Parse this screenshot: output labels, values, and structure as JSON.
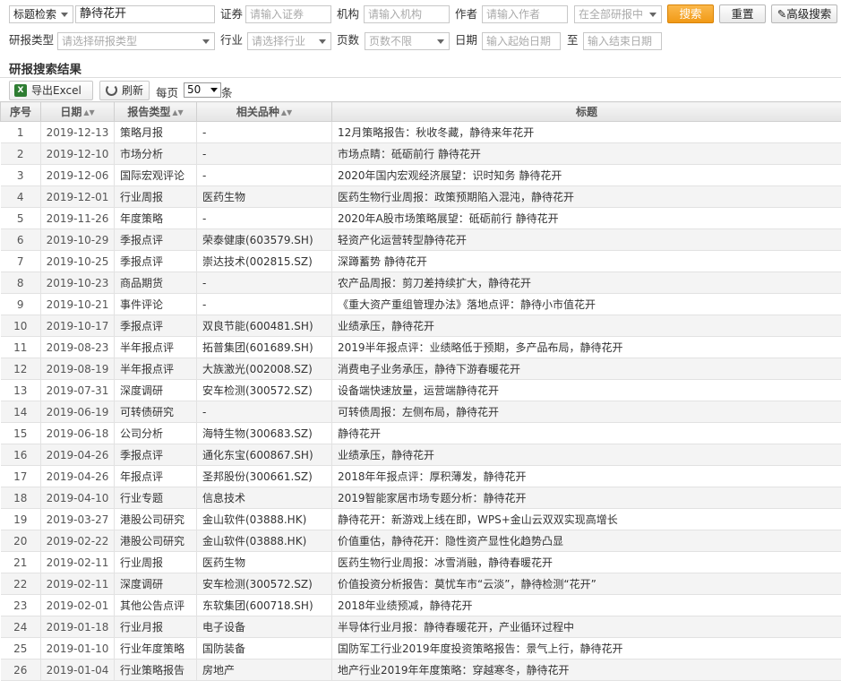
{
  "search": {
    "mode": "标题检索",
    "keyword": "静待花开",
    "security_label": "证券",
    "security_placeholder": "请输入证券",
    "org_label": "机构",
    "org_placeholder": "请输入机构",
    "author_label": "作者",
    "author_placeholder": "请输入作者",
    "scope": "在全部研报中",
    "search_btn": "搜索",
    "reset_btn": "重置",
    "advanced_btn": "高级搜索",
    "type_label": "研报类型",
    "type_placeholder": "请选择研报类型",
    "industry_label": "行业",
    "industry_placeholder": "请选择行业",
    "pages_label": "页数",
    "pages_value": "页数不限",
    "date_label": "日期",
    "start_placeholder": "输入起始日期",
    "to_label": "至",
    "end_placeholder": "输入结束日期"
  },
  "results": {
    "title": "研报搜索结果",
    "export_label": "导出Excel",
    "refresh_label": "刷新",
    "per_page_label": "每页",
    "per_page_value": "50",
    "per_page_unit": "条"
  },
  "table": {
    "headers": [
      "序号",
      "日期",
      "报告类型",
      "相关品种",
      "标题"
    ],
    "rows": [
      [
        "1",
        "2019-12-13",
        "策略月报",
        "-",
        "12月策略报告：秋收冬藏，静待来年花开"
      ],
      [
        "2",
        "2019-12-10",
        "市场分析",
        "-",
        "市场点睛：砥砺前行 静待花开"
      ],
      [
        "3",
        "2019-12-06",
        "国际宏观评论",
        "-",
        "2020年国内宏观经济展望：识时知务 静待花开"
      ],
      [
        "4",
        "2019-12-01",
        "行业周报",
        "医药生物",
        "医药生物行业周报：政策预期陷入混沌，静待花开"
      ],
      [
        "5",
        "2019-11-26",
        "年度策略",
        "-",
        "2020年A股市场策略展望：砥砺前行 静待花开"
      ],
      [
        "6",
        "2019-10-29",
        "季报点评",
        "荣泰健康(603579.SH)",
        "轻资产化运营转型静待花开"
      ],
      [
        "7",
        "2019-10-25",
        "季报点评",
        "崇达技术(002815.SZ)",
        "深蹲蓄势 静待花开"
      ],
      [
        "8",
        "2019-10-23",
        "商品期货",
        "-",
        "农产品周报：剪刀差持续扩大，静待花开"
      ],
      [
        "9",
        "2019-10-21",
        "事件评论",
        "-",
        "《重大资产重组管理办法》落地点评：静待小市值花开"
      ],
      [
        "10",
        "2019-10-17",
        "季报点评",
        "双良节能(600481.SH)",
        "业绩承压，静待花开"
      ],
      [
        "11",
        "2019-08-23",
        "半年报点评",
        "拓普集团(601689.SH)",
        "2019半年报点评：业绩略低于预期，多产品布局，静待花开"
      ],
      [
        "12",
        "2019-08-19",
        "半年报点评",
        "大族激光(002008.SZ)",
        "消费电子业务承压，静待下游春暖花开"
      ],
      [
        "13",
        "2019-07-31",
        "深度调研",
        "安车检测(300572.SZ)",
        "设备端快速放量，运营端静待花开"
      ],
      [
        "14",
        "2019-06-19",
        "可转债研究",
        "-",
        "可转债周报：左侧布局，静待花开"
      ],
      [
        "15",
        "2019-06-18",
        "公司分析",
        "海特生物(300683.SZ)",
        "静待花开"
      ],
      [
        "16",
        "2019-04-26",
        "季报点评",
        "通化东宝(600867.SH)",
        "业绩承压，静待花开"
      ],
      [
        "17",
        "2019-04-26",
        "年报点评",
        "圣邦股份(300661.SZ)",
        "2018年年报点评：厚积薄发，静待花开"
      ],
      [
        "18",
        "2019-04-10",
        "行业专题",
        "信息技术",
        "2019智能家居市场专题分析：静待花开"
      ],
      [
        "19",
        "2019-03-27",
        "港股公司研究",
        "金山软件(03888.HK)",
        "静待花开：新游戏上线在即，WPS+金山云双双实现高增长"
      ],
      [
        "20",
        "2019-02-22",
        "港股公司研究",
        "金山软件(03888.HK)",
        "价值重估，静待花开：隐性资产显性化趋势凸显"
      ],
      [
        "21",
        "2019-02-11",
        "行业周报",
        "医药生物",
        "医药生物行业周报：冰雪消融，静待春暖花开"
      ],
      [
        "22",
        "2019-02-11",
        "深度调研",
        "安车检测(300572.SZ)",
        "价值投资分析报告：莫忧车市“云淡”，静待检测“花开”"
      ],
      [
        "23",
        "2019-02-01",
        "其他公告点评",
        "东软集团(600718.SH)",
        "2018年业绩预减，静待花开"
      ],
      [
        "24",
        "2019-01-18",
        "行业月报",
        "电子设备",
        "半导体行业月报：静待春暖花开，产业循环过程中"
      ],
      [
        "25",
        "2019-01-10",
        "行业年度策略",
        "国防装备",
        "国防军工行业2019年度投资策略报告：景气上行，静待花开"
      ],
      [
        "26",
        "2019-01-04",
        "行业策略报告",
        "房地产",
        "地产行业2019年年度策略：穿越寒冬，静待花开"
      ]
    ]
  }
}
